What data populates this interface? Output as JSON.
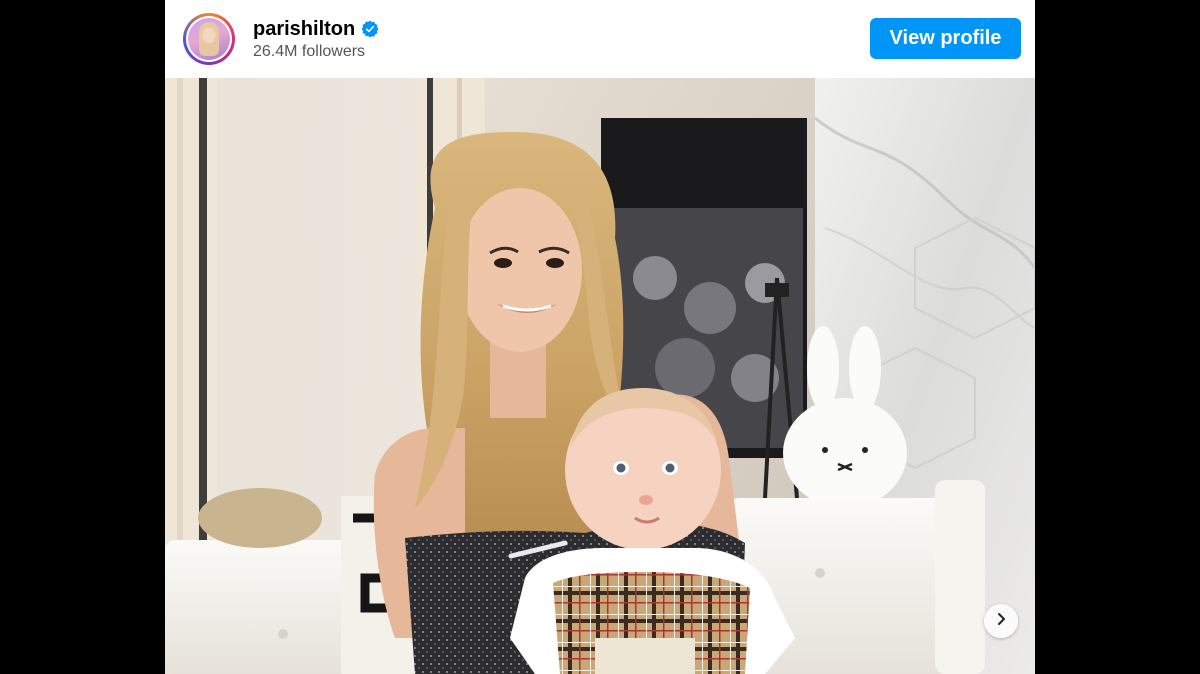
{
  "header": {
    "username": "parishilton",
    "followers": "26.4M followers",
    "verified_icon": "verified-badge-icon",
    "view_profile_label": "View profile",
    "accent_color": "#0095f6"
  },
  "post": {
    "media_type": "photo",
    "carousel_next_icon": "chevron-right-icon"
  }
}
